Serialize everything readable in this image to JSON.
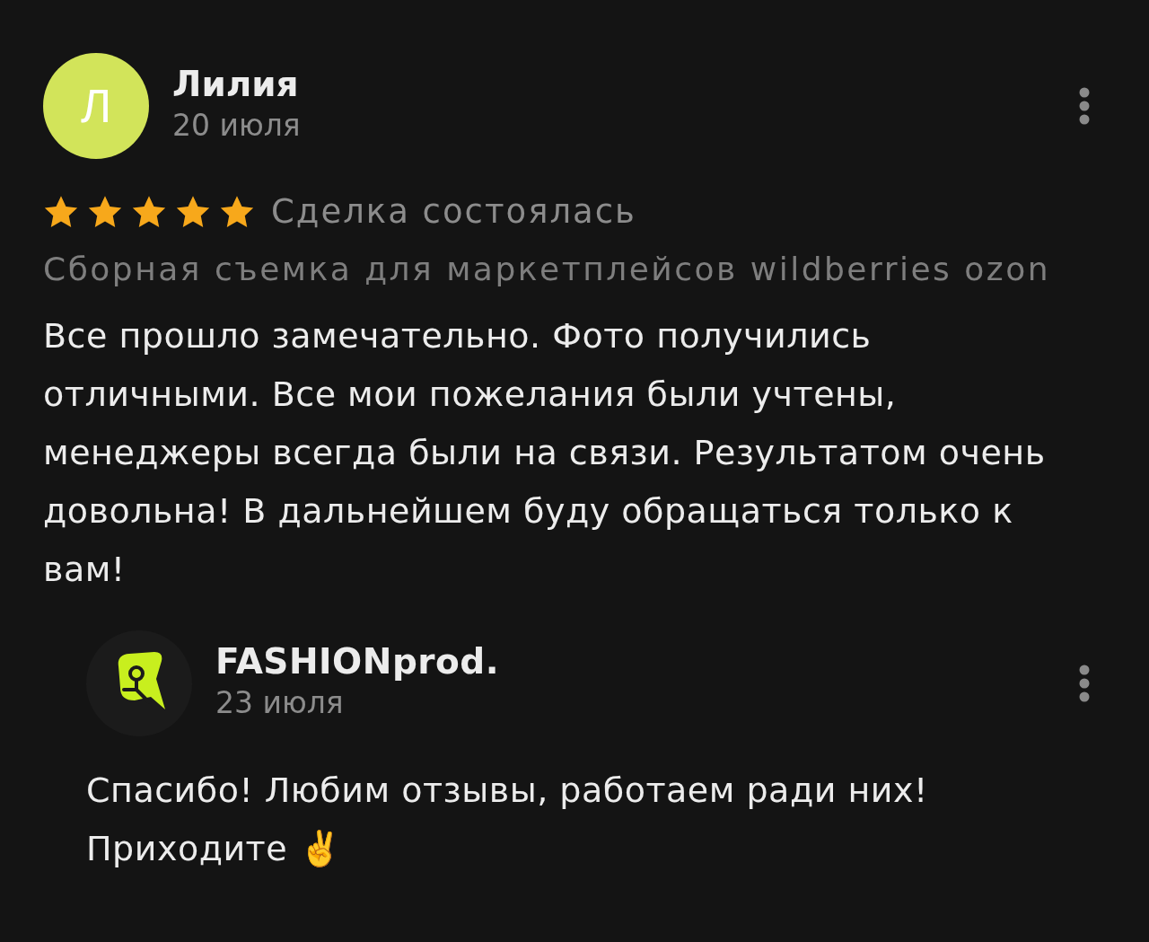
{
  "review": {
    "author": {
      "initial": "Л",
      "name": "Лилия",
      "date": "20 июля"
    },
    "stars": 5,
    "status": "Сделка состоялась",
    "service": "Сборная съемка для маркетплейсов wildberries ozon",
    "text": "Все прошло замечательно. Фото получились отличными. Все мои пожелания были учтены, менеджеры всегда были на связи. Результатом очень довольна! В дальнейшем буду обращаться только к вам!"
  },
  "reply": {
    "author": {
      "name": "FASHIONprod.",
      "date": "23 июля"
    },
    "text": "Спасибо! Любим отзывы, работаем ради них! Приходите ✌️"
  }
}
